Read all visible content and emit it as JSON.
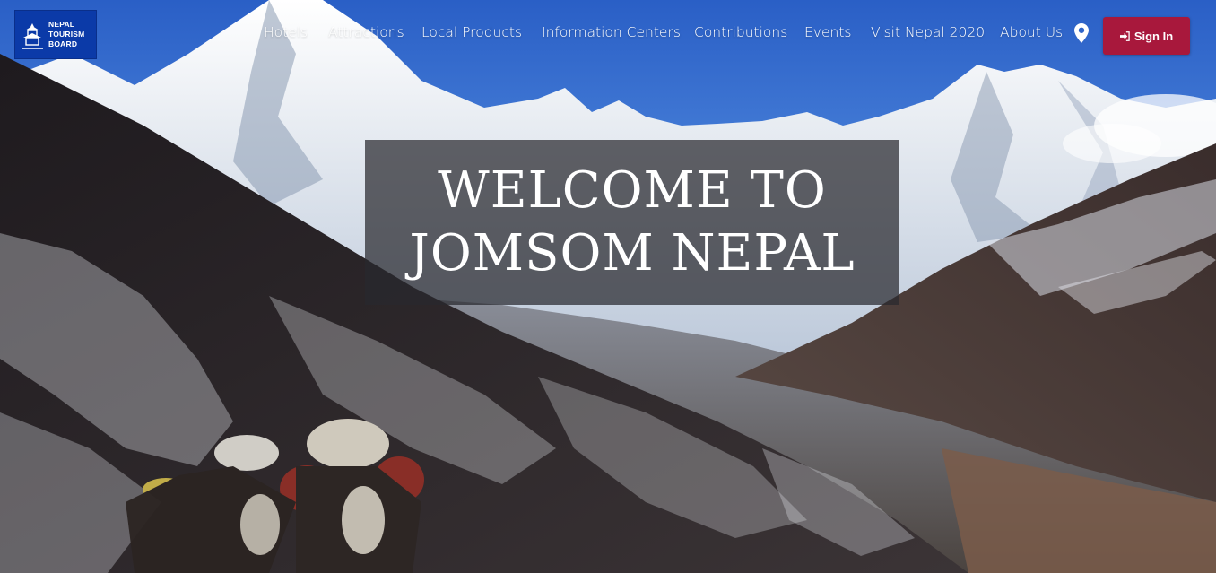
{
  "brand": {
    "logo_lines": [
      "NEPAL",
      "TOURISM",
      "BOARD"
    ],
    "logo_color": "#0b3aa8"
  },
  "nav": {
    "items": [
      {
        "label": "Hotels"
      },
      {
        "label": "Attractions"
      },
      {
        "label": "Local Products"
      },
      {
        "label": "Information Centers"
      },
      {
        "label": "Contributions"
      },
      {
        "label": "Events"
      },
      {
        "label": "Visit Nepal 2020"
      },
      {
        "label": "About Us"
      }
    ],
    "location_icon": "map-marker-icon"
  },
  "signin": {
    "label": "Sign In",
    "icon": "sign-in-icon",
    "color": "#a8183c"
  },
  "hero": {
    "title_line1": "WELCOME TO",
    "title_line2": "JOMSOM NEPAL"
  }
}
